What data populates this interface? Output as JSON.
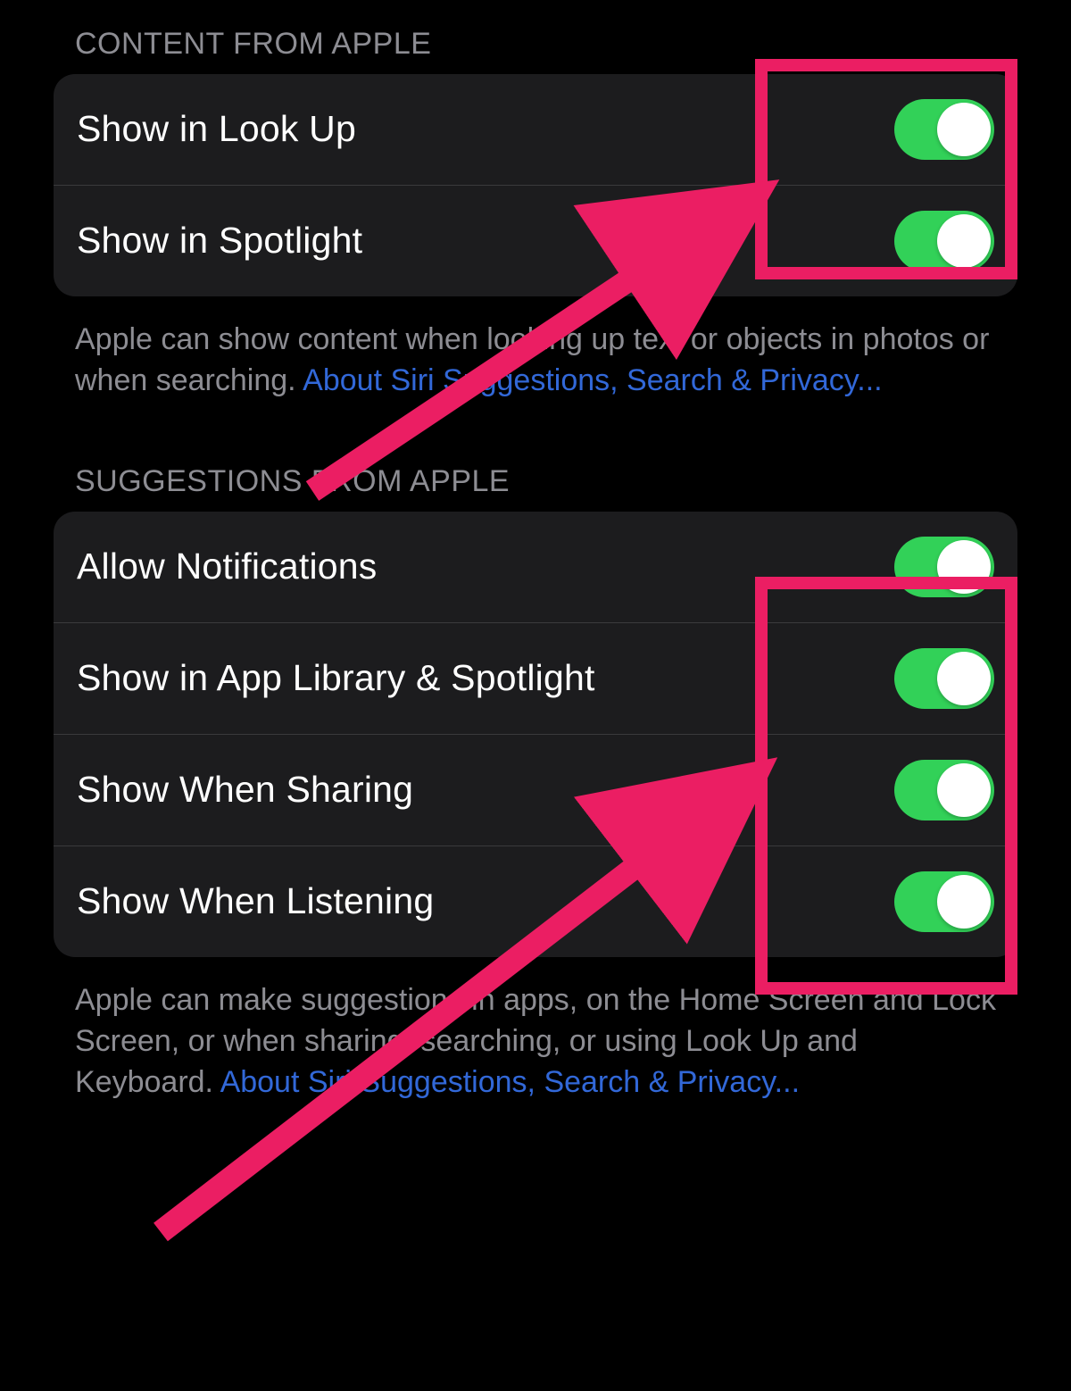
{
  "sections": [
    {
      "header": "CONTENT FROM APPLE",
      "rows": [
        {
          "label": "Show in Look Up",
          "on": true
        },
        {
          "label": "Show in Spotlight",
          "on": true
        }
      ],
      "footer_text": "Apple can show content when looking up text or objects in photos or when searching. ",
      "footer_link": "About Siri Suggestions, Search & Privacy..."
    },
    {
      "header": "SUGGESTIONS FROM APPLE",
      "rows": [
        {
          "label": "Allow Notifications",
          "on": true
        },
        {
          "label": "Show in App Library & Spotlight",
          "on": true
        },
        {
          "label": "Show When Sharing",
          "on": true
        },
        {
          "label": "Show When Listening",
          "on": true
        }
      ],
      "footer_text": "Apple can make suggestions in apps, on the Home Screen and Lock Screen, or when sharing, searching, or using Look Up and Keyboard. ",
      "footer_link": "About Siri Suggestions, Search & Privacy..."
    }
  ],
  "annotation": {
    "highlight_color": "#eb1e63"
  }
}
